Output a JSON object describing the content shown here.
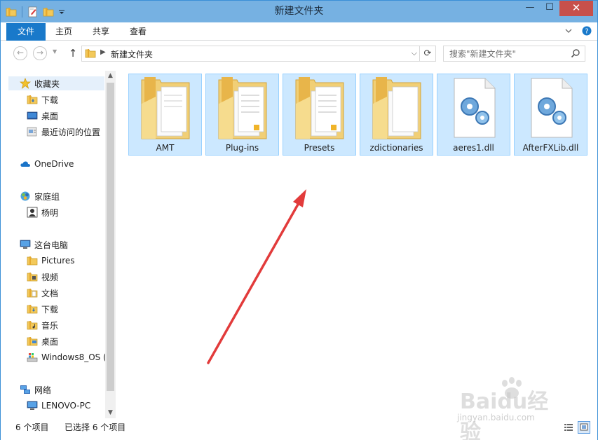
{
  "window": {
    "title": "新建文件夹",
    "minimize_glyph": "—",
    "maximize_glyph": "☐",
    "close_glyph": "✕"
  },
  "ribbon": {
    "tabs": [
      "文件",
      "主页",
      "共享",
      "查看"
    ]
  },
  "address_bar": {
    "path": "新建文件夹",
    "search_placeholder": "搜索\"新建文件夹\""
  },
  "nav_pane": {
    "items": [
      {
        "label": "收藏夹",
        "icon": "star-icon"
      },
      {
        "label": "下载",
        "icon": "folder-icon"
      },
      {
        "label": "桌面",
        "icon": "desktop-icon"
      },
      {
        "label": "最近访问的位置",
        "icon": "recent-places-icon"
      },
      {
        "label": "OneDrive",
        "icon": "cloud-icon"
      },
      {
        "label": "家庭组",
        "icon": "homegroup-icon"
      },
      {
        "label": "杨明",
        "icon": "user-icon"
      },
      {
        "label": "这台电脑",
        "icon": "computer-icon"
      },
      {
        "label": "Pictures",
        "icon": "folder-icon"
      },
      {
        "label": "视频",
        "icon": "video-folder-icon"
      },
      {
        "label": "文档",
        "icon": "documents-folder-icon"
      },
      {
        "label": "下载",
        "icon": "download-folder-icon"
      },
      {
        "label": "音乐",
        "icon": "music-folder-icon"
      },
      {
        "label": "桌面",
        "icon": "desktop-folder-icon"
      },
      {
        "label": "Windows8_OS (",
        "icon": "drive-icon"
      },
      {
        "label": "网络",
        "icon": "network-icon"
      },
      {
        "label": "LENOVO-PC",
        "icon": "computer-icon"
      }
    ]
  },
  "files": [
    {
      "name": "AMT",
      "type": "folder"
    },
    {
      "name": "Plug-ins",
      "type": "folder"
    },
    {
      "name": "Presets",
      "type": "folder"
    },
    {
      "name": "zdictionaries",
      "type": "folder"
    },
    {
      "name": "aeres1.dll",
      "type": "dll"
    },
    {
      "name": "AfterFXLib.dll",
      "type": "dll"
    }
  ],
  "status_bar": {
    "item_count": "6 个项目",
    "selected_count": "已选择 6 个项目"
  },
  "watermark": {
    "main": "Baidu经验",
    "sub": "jingyan.baidu.com"
  },
  "colors": {
    "title_bar": "#76b1e2",
    "file_tab": "#1979ca",
    "selection_fill": "#cce8ff",
    "selection_border": "#99d1ff",
    "annotation_arrow": "#e23b3b"
  }
}
